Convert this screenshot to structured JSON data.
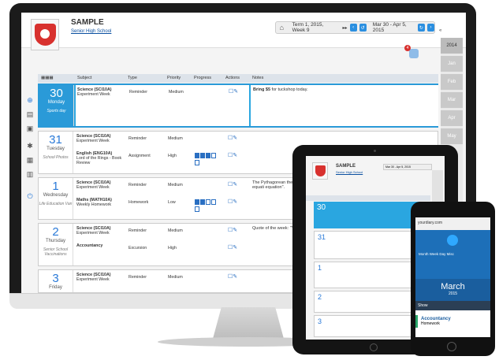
{
  "school": {
    "name": "SAMPLE",
    "subtitle": "Senior High School"
  },
  "term": {
    "label": "Term 1, 2015, Week 9",
    "range": "Mar 30 - Apr 5, 2015"
  },
  "years": [
    "2014",
    "Jan",
    "Feb",
    "Mar",
    "Apr",
    "May"
  ],
  "notifications": {
    "count": "4"
  },
  "table": {
    "headers": [
      "Subject",
      "Type",
      "Priority",
      "Progress",
      "Actions",
      "Notes"
    ]
  },
  "days": [
    {
      "num": "30",
      "name": "Monday",
      "event": "Sports day",
      "active": true,
      "entries": [
        {
          "subject": "Science (SCI10A)",
          "sub": "Experiment Week",
          "type": "Reminder",
          "priority": "Medium",
          "progress": 0
        }
      ],
      "note_bold": "Bring $5",
      "note": " for tuckshop today."
    },
    {
      "num": "31",
      "name": "Tuesday",
      "event": "School Photos",
      "active": false,
      "entries": [
        {
          "subject": "Science (SCI10A)",
          "sub": "Experiment Week",
          "type": "Reminder",
          "priority": "Medium",
          "progress": 0
        },
        {
          "subject": "English (ENG10A)",
          "sub": "Lord of the Rings - Book Review",
          "type": "Assignment",
          "priority": "High",
          "progress": 3
        }
      ],
      "note_bold": "",
      "note": ""
    },
    {
      "num": "1",
      "name": "Wednesday",
      "event": "Life Education Van",
      "active": false,
      "entries": [
        {
          "subject": "Science (SCI10A)",
          "sub": "Experiment Week",
          "type": "Reminder",
          "priority": "Medium",
          "progress": 0
        },
        {
          "subject": "Maths (MATH10A)",
          "sub": "Weekly Homework",
          "type": "Homework",
          "priority": "Low",
          "progress": 2
        }
      ],
      "note_bold": "",
      "note": "The Pythagorean theorem among the three sides of opposite the right angle be written as an equati equation\"."
    },
    {
      "num": "2",
      "name": "Thursday",
      "event": "Senior School Vaccinations",
      "active": false,
      "entries": [
        {
          "subject": "Science (SCI10A)",
          "sub": "Experiment Week",
          "type": "Reminder",
          "priority": "Medium",
          "progress": 0
        },
        {
          "subject": "Accountancy",
          "sub": "",
          "type": "Excursion",
          "priority": "High",
          "progress": 0
        }
      ],
      "note_bold": "",
      "note": "Quote of the week: \"You"
    },
    {
      "num": "3",
      "name": "Friday",
      "event": "",
      "active": false,
      "entries": [
        {
          "subject": "Science (SCI10A)",
          "sub": "Experiment Week",
          "type": "Reminder",
          "priority": "Medium",
          "progress": 0
        }
      ],
      "note_bold": "",
      "note": ""
    }
  ],
  "phone": {
    "url": "yourdiary.com",
    "tabs": "Month  Week  Day  Misc",
    "month": "March",
    "year": "2015",
    "bar": "Show",
    "item_title": "Accountancy",
    "item_sub": "Homework"
  }
}
